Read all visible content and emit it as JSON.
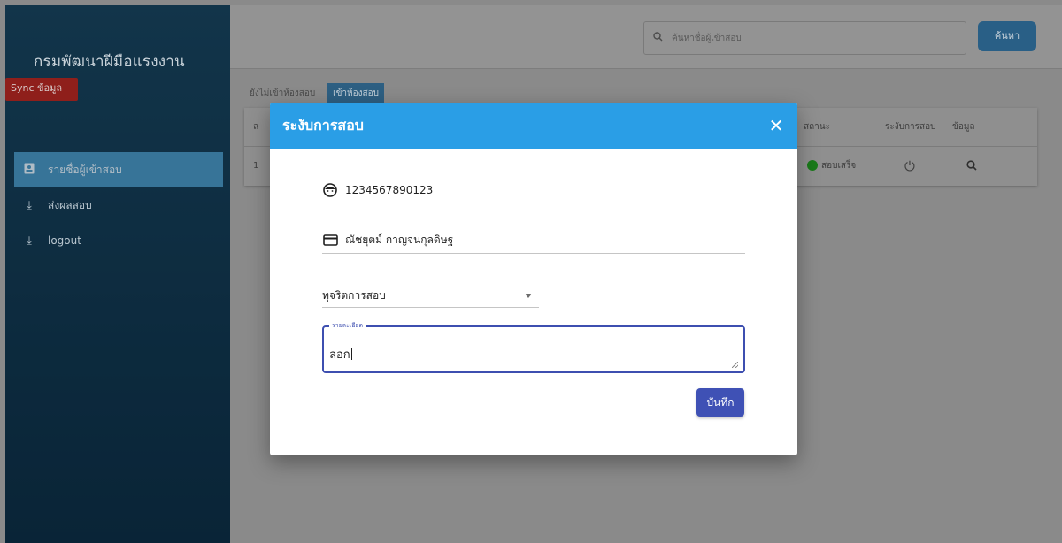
{
  "sidebar": {
    "brand": "กรมพัฒนาฝีมือแรงงาน",
    "sync_label": "Sync ข้อมูล",
    "items": [
      {
        "label": "รายชื่อผู้เข้าสอบ",
        "icon": "id-card-icon",
        "active": true
      },
      {
        "label": "ส่งผลสอบ",
        "icon": "download-icon",
        "active": false
      },
      {
        "label": "logout",
        "icon": "download-icon",
        "active": false
      }
    ]
  },
  "topbar": {
    "search_placeholder": "ค้นหาชื่อผู้เข้าสอบ",
    "search_button": "ค้นหา"
  },
  "tabs": [
    {
      "label": "ยังไม่เข้าห้องสอบ",
      "active": false
    },
    {
      "label": "เข้าห้องสอบ",
      "active": true
    }
  ],
  "table": {
    "headers": {
      "index": "ล",
      "status": "สถานะ",
      "suspend": "ระงับการสอบ",
      "info": "ข้อมูล"
    },
    "rows": [
      {
        "index": "1",
        "status": "สอบเสร็จ",
        "status_color": "#1a7a1a"
      }
    ]
  },
  "modal": {
    "title": "ระงับการสอบ",
    "id_number": "1234567890123",
    "name": "ณัชยุตม์ กาญจนกุลดิษฐ",
    "reason_select": "ทุจริตการสอบ",
    "details_label": "รายละเอียด",
    "details_value": "ลอก",
    "save_label": "บันทึก",
    "header_color": "#2a9ee6",
    "button_color": "#3f51b5"
  }
}
